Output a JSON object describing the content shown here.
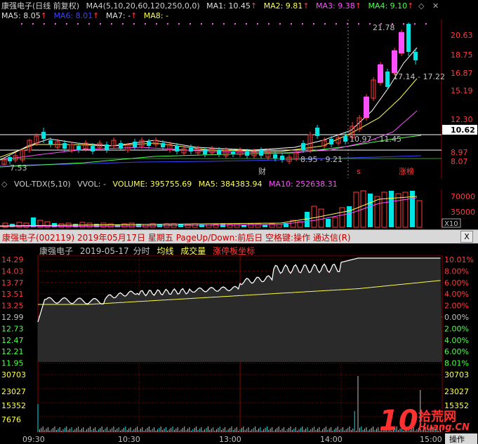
{
  "top_header": {
    "stock": "康强电子(日线 前复权)",
    "ma_setting": "MA4(5,10,20,60,120,250,0,0)",
    "ma1": "MA1: 10.45",
    "ma2": "MA2: 9.81",
    "ma3": "MA3: 9.38",
    "ma4": "MA4: 9.10",
    "ma5": "MA5: 8.05",
    "ma6": "MA6: 8.01",
    "ma7": "MA7: -",
    "ma8": "MA8: -",
    "up_arrow": "↑",
    "expand_icon": "◇",
    "close_icon": "✕"
  },
  "kline": {
    "price_axis": [
      "20.63",
      "18.75",
      "16.87",
      "15.19",
      "12.30",
      "10.62",
      "8.97",
      "8.07"
    ],
    "annotations": {
      "high": "21.78",
      "right_label": "17.14 - 17.22",
      "mid_label": "10.97 - 11.45",
      "low_label": "8.95 - 9.21",
      "left_low": "7.53",
      "cai": "财",
      "s_mark": "s",
      "zhangbang": "涨榜"
    },
    "current_price_tag": "10.62"
  },
  "volume_header": {
    "vol_name": "VOL-TDX(5,10)",
    "vvol": "VVOL: -",
    "volume": "VOLUME: 395755.69",
    "ma5": "MA5: 384383.94",
    "ma10": "MA10: 252638.31"
  },
  "volume_axis": [
    "70000",
    "35000",
    "X10"
  ],
  "subwin_bar": {
    "title": "康强电子(002119)  2019年05月17日  星期五  PageUp/Down:前后日  空格键:操作  通达信(R)",
    "x_button": "X"
  },
  "intraday": {
    "name": "康强电子",
    "date": "2019-05-17",
    "mode": "分时",
    "avg_line": "均线",
    "volume_label": "成交量",
    "limit_label": "涨停板坐标",
    "price_axis": [
      "14.29",
      "14.03",
      "13.77",
      "13.51",
      "13.25",
      "12.99",
      "12.73",
      "12.47",
      "12.21",
      "11.95"
    ],
    "pct_axis": [
      "10.01%",
      "8.00%",
      "6.00%",
      "4.00%",
      "2.00%",
      "0.00%",
      "2.00%",
      "4.00%",
      "6.00%",
      "8.01%"
    ],
    "vol_axis_left": [
      "30703",
      "23027",
      "15352",
      "7676"
    ],
    "vol_axis_right": [
      "30703",
      "23027",
      "15352"
    ],
    "time_axis": [
      "09:30",
      "10:30",
      "13:00",
      "14:00"
    ],
    "corner_time": "15:00",
    "corner_op": "操作"
  },
  "watermark": {
    "number": "10",
    "text1": "拾荒网",
    "text2": "Huang.CN"
  },
  "colors": {
    "up": "#ff3c3c",
    "down": "#00e4e4",
    "avg": "#ffff50",
    "grid": "#8b0000",
    "white_bar": "#ffffff"
  }
}
